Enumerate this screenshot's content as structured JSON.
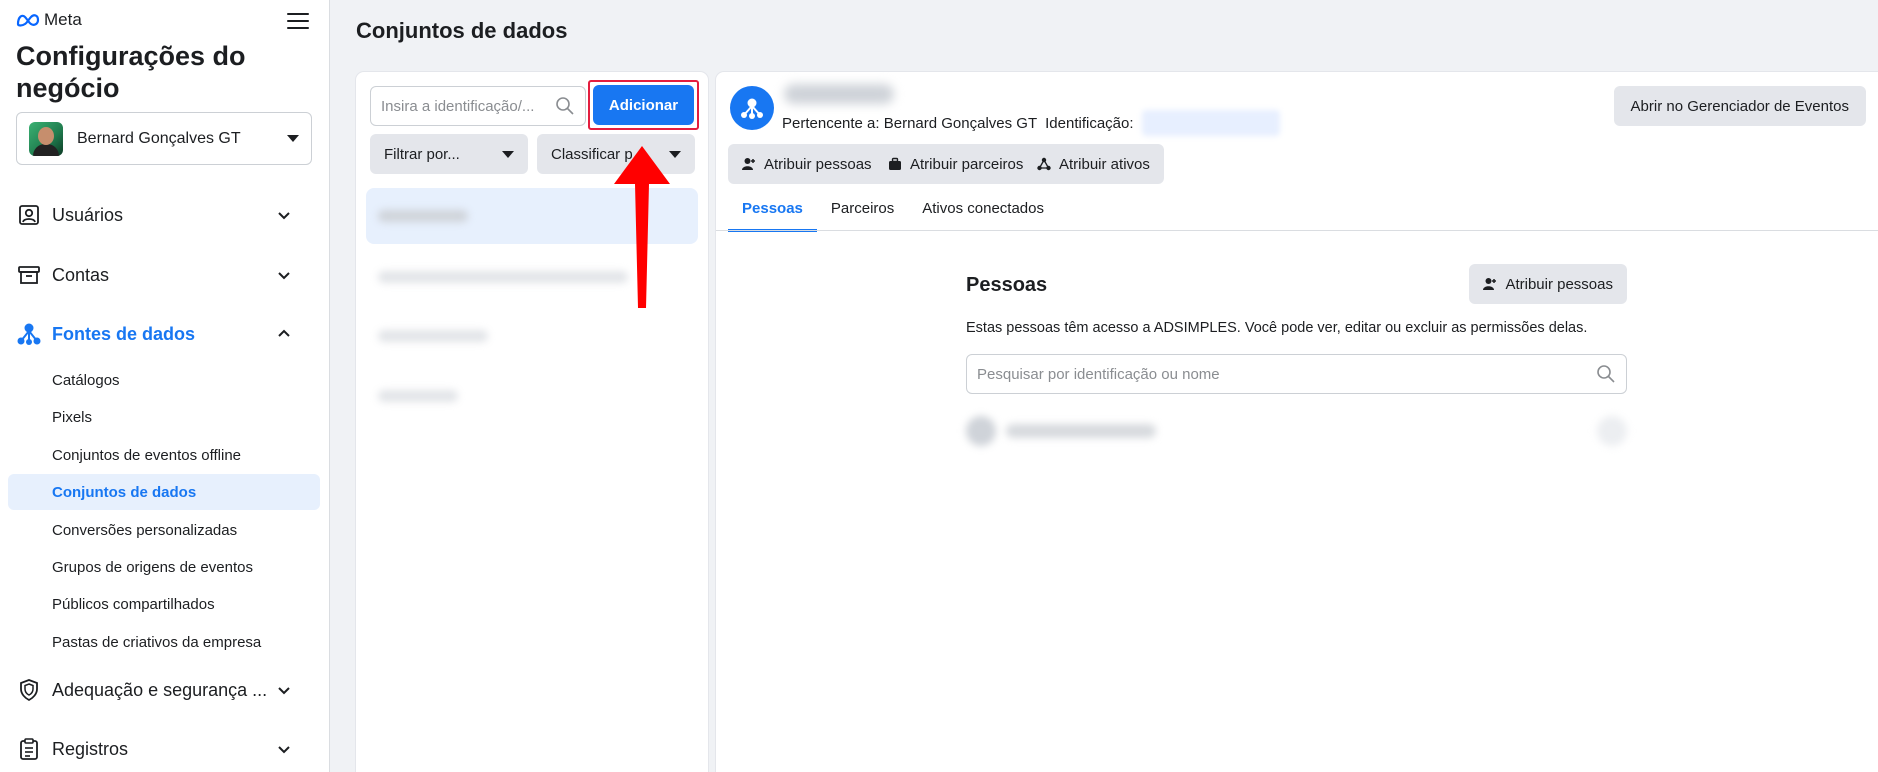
{
  "sidebar": {
    "brand": "Meta",
    "title": "Configurações do negócio",
    "business_name": "Bernard Gonçalves GT",
    "nav": [
      {
        "label": "Usuários",
        "icon": "users-icon"
      },
      {
        "label": "Contas",
        "icon": "accounts-icon"
      },
      {
        "label": "Fontes de dados",
        "icon": "data-sources-icon",
        "active": true
      },
      {
        "label": "Adequação e segurança ...",
        "icon": "shield-icon"
      },
      {
        "label": "Registros",
        "icon": "clipboard-icon"
      }
    ],
    "sub_items": [
      "Catálogos",
      "Pixels",
      "Conjuntos de eventos offline",
      "Conjuntos de dados",
      "Conversões personalizadas",
      "Grupos de origens de eventos",
      "Públicos compartilhados",
      "Pastas de criativos da empresa"
    ]
  },
  "main": {
    "page_title": "Conjuntos de dados",
    "list": {
      "search_placeholder": "Insira a identificação/...",
      "add_label": "Adicionar",
      "filter_label": "Filtrar por...",
      "sort_label": "Classificar p..."
    },
    "detail": {
      "owner_label": "Pertencente a: Bernard Gonçalves GT",
      "id_label": "Identificação:",
      "open_events_manager": "Abrir no Gerenciador de Eventos",
      "actions": [
        "Atribuir pessoas",
        "Atribuir parceiros",
        "Atribuir ativos"
      ],
      "tabs": [
        "Pessoas",
        "Parceiros",
        "Ativos conectados"
      ],
      "people": {
        "title": "Pessoas",
        "assign_label": "Atribuir pessoas",
        "description": "Estas pessoas têm acesso a ADSIMPLES. Você pode ver, editar ou excluir as permissões delas.",
        "search_placeholder": "Pesquisar por identificação ou nome"
      }
    }
  },
  "colors": {
    "accent": "#1877f2",
    "highlight": "#e41e3f",
    "annotation_arrow": "#ff0000"
  }
}
